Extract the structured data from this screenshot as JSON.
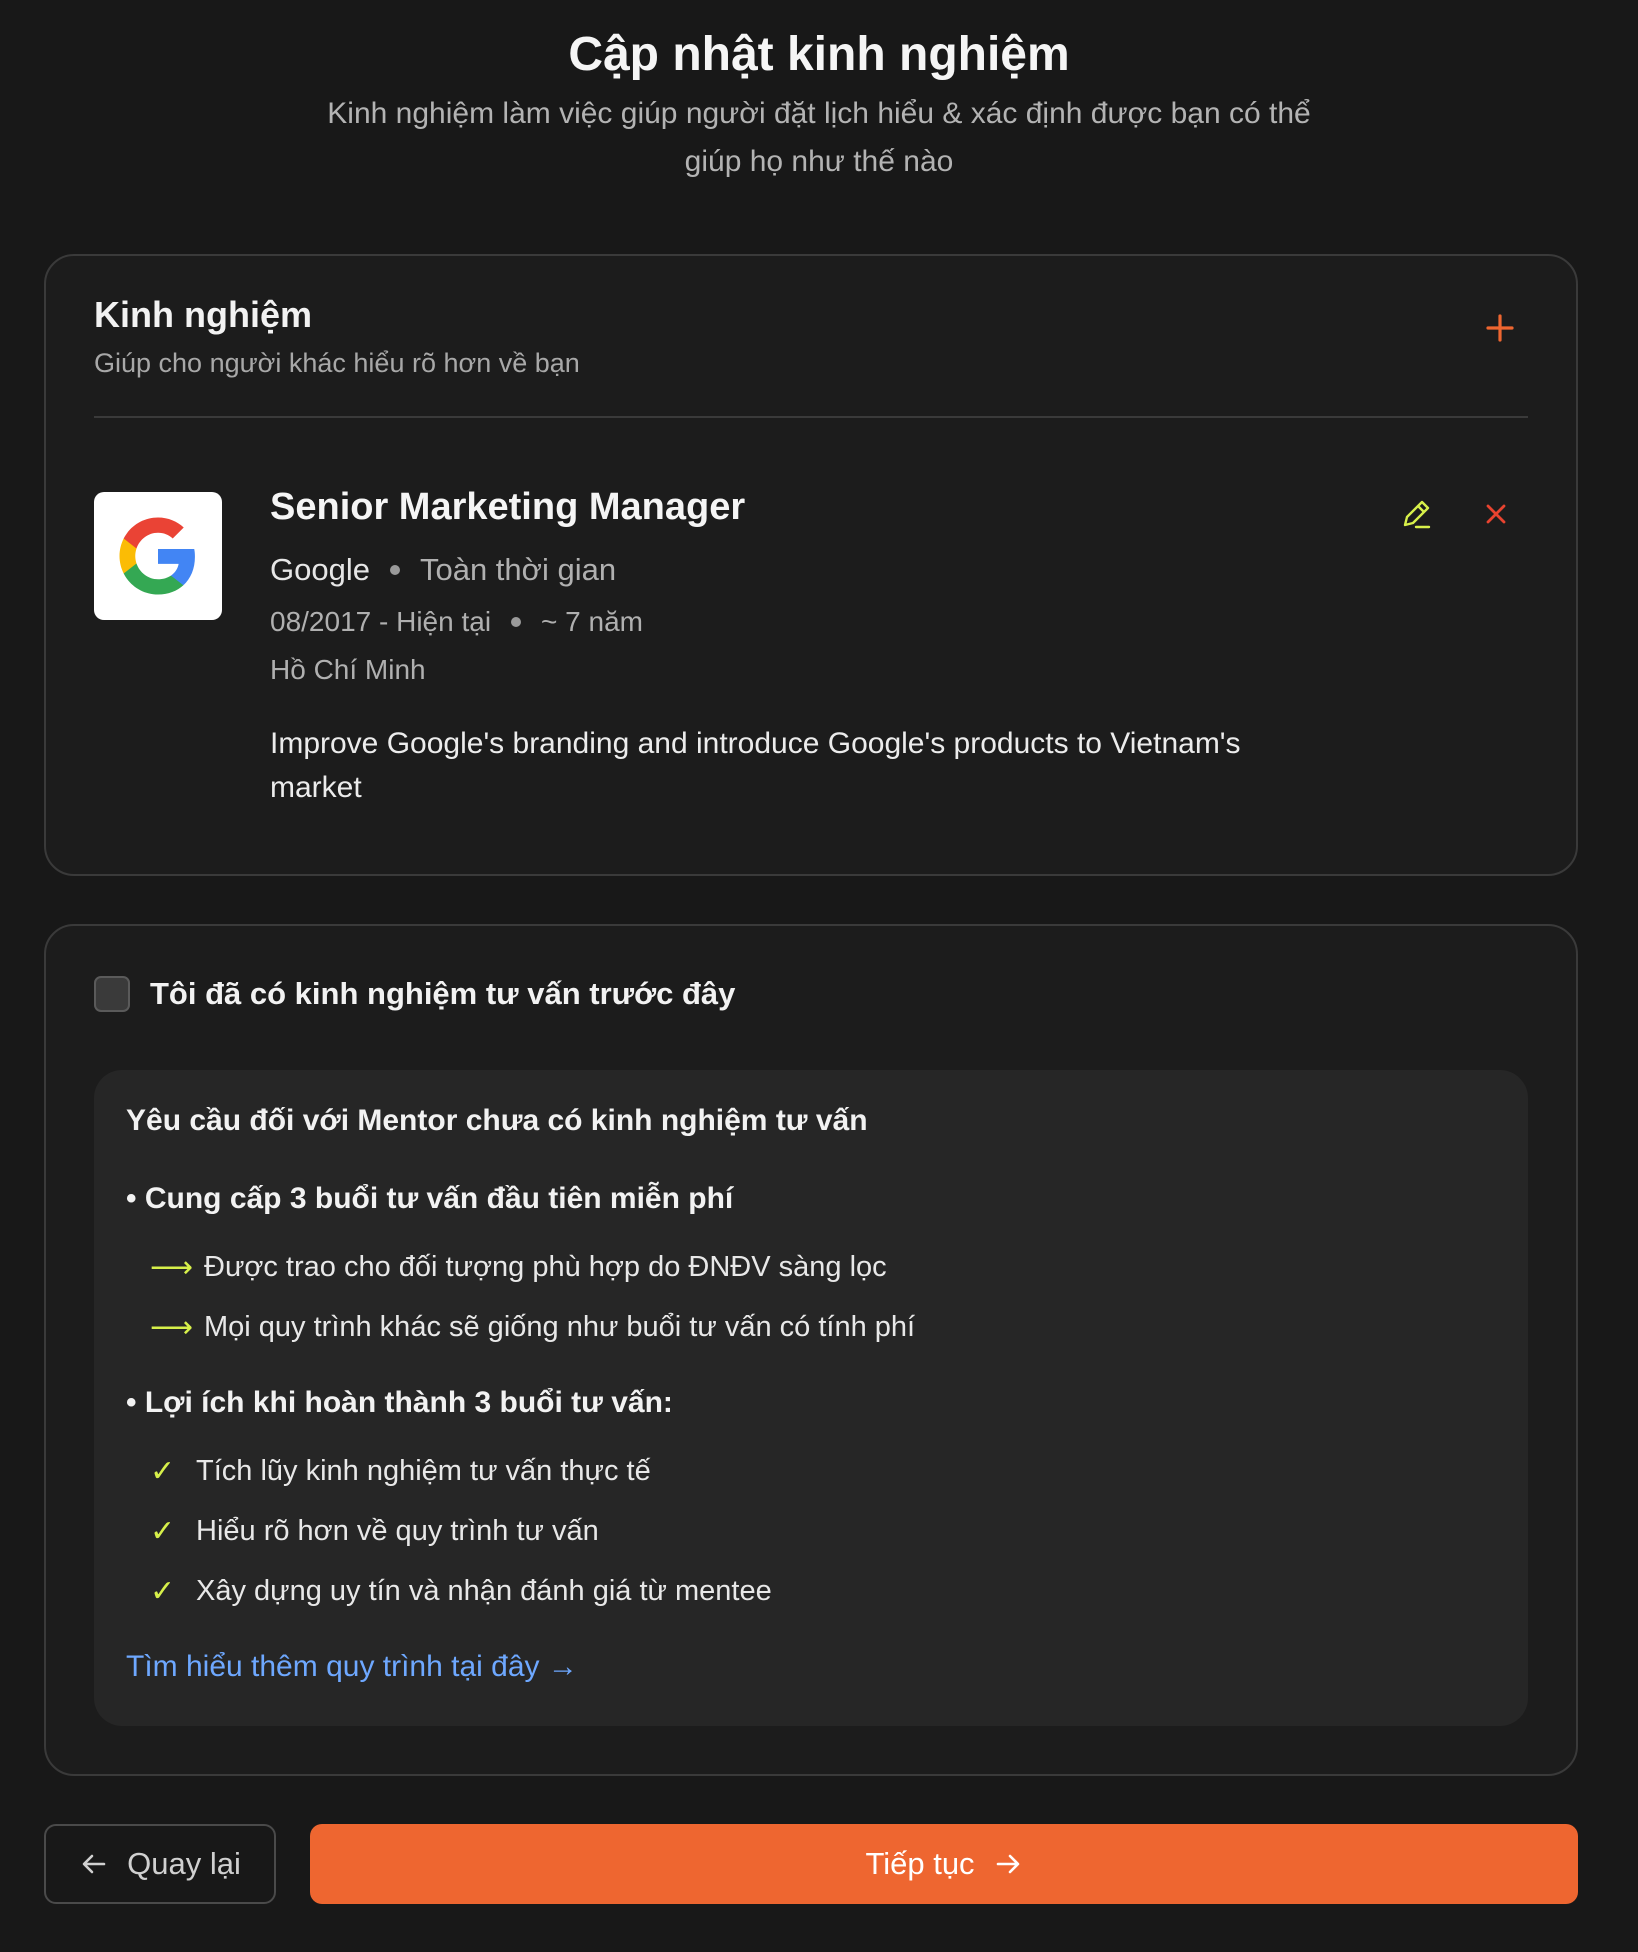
{
  "header": {
    "title": "Cập nhật kinh nghiệm",
    "subtitle": "Kinh nghiệm làm việc giúp người đặt lịch hiểu & xác định được bạn có thể giúp họ như thế nào"
  },
  "experience": {
    "section_title": "Kinh nghiệm",
    "section_subtitle": "Giúp cho người khác hiểu rõ hơn về bạn",
    "item": {
      "title": "Senior Marketing Manager",
      "company": "Google",
      "employment_type": "Toàn thời gian",
      "period": "08/2017 - Hiện tại",
      "duration": "~ 7 năm",
      "location": "Hồ Chí Minh",
      "description": "Improve Google's branding and introduce Google's products to Vietnam's market"
    }
  },
  "consulting": {
    "checkbox_label": "Tôi đã có kinh nghiệm tư vấn trước đây",
    "checked": false,
    "info_title": "Yêu cầu đối với Mentor chưa có kinh nghiệm tư vấn",
    "section1_heading": "• Cung cấp 3 buổi tư vấn đầu tiên miễn phí",
    "section1_items": [
      "Được trao cho đối tượng phù hợp do ĐNĐV sàng lọc",
      "Mọi quy trình khác sẽ giống như buổi tư vấn có tính phí"
    ],
    "section2_heading": "• Lợi ích khi hoàn thành 3 buổi tư vấn:",
    "section2_items": [
      "Tích lũy kinh nghiệm tư vấn thực tế",
      "Hiểu rõ hơn về quy trình tư vấn",
      "Xây dựng uy tín và nhận đánh giá từ mentee"
    ],
    "learn_more": "Tìm hiểu thêm quy trình tại đây →"
  },
  "footer": {
    "back_label": "Quay lại",
    "continue_label": "Tiếp tục"
  },
  "colors": {
    "accent": "#ee6630",
    "highlight": "#d7f04a",
    "link": "#6ea8ff",
    "delete": "#e8432f"
  },
  "icons": {
    "add": "plus-icon",
    "edit": "pencil-icon",
    "delete": "close-icon",
    "logo": "google-logo",
    "back": "arrow-left-icon",
    "continue": "arrow-right-icon"
  }
}
